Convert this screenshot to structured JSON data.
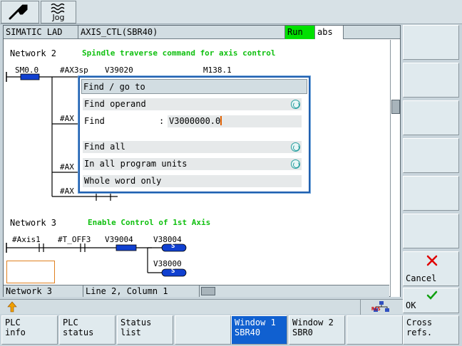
{
  "toolbar": {
    "wrench_icon": "wrench-icon",
    "jog_label": "Jog"
  },
  "editor": {
    "lad_label": "SIMATIC LAD",
    "block_label": "AXIS_CTL(SBR40)",
    "run_label": "Run",
    "abs_label": "abs",
    "status": {
      "network": "Network 3",
      "position": "Line  2, Column  1"
    }
  },
  "ladder": {
    "network2": {
      "title": "Network 2",
      "comment": "Spindle traverse command for axis control",
      "labels": {
        "sm": "SM0.0",
        "ax3sp": "#AX3sp",
        "v39020": "V39020",
        "m138": "M138.1",
        "ax_a": "#AX",
        "ax_b": "#AX",
        "ax_c": "#AX"
      }
    },
    "network3": {
      "title": "Network 3",
      "comment": "Enable Control of 1st Axis",
      "labels": {
        "axis1": "#Axis1",
        "toff3": "#T_OFF3",
        "v39004": "V39004",
        "v38004": "V38004",
        "v38000": "V38000",
        "coil_s1": "S",
        "coil_s2": "S"
      }
    }
  },
  "dialog": {
    "title": "Find / go to",
    "find_operand": "Find operand",
    "find_label": "Find",
    "find_colon": ":",
    "find_value": "V3000000.0",
    "find_all": "Find all",
    "in_all_units": "In all program units",
    "whole_word": "Whole word only"
  },
  "right_keys": {
    "cancel": "Cancel",
    "ok": "OK"
  },
  "hint": {
    "rcs_label": "RCS"
  },
  "bottom_keys": [
    {
      "label": "PLC\ninfo",
      "active": false
    },
    {
      "label": "PLC\nstatus",
      "active": false
    },
    {
      "label": "Status\nlist",
      "active": false
    },
    {
      "label": "",
      "active": false
    },
    {
      "label": "Window 1\nSBR40",
      "active": true
    },
    {
      "label": "Window 2\nSBR0",
      "active": false
    },
    {
      "label": "",
      "active": false
    },
    {
      "label": "Cross\nrefs.",
      "active": false
    }
  ],
  "colors": {
    "run": "#00e000",
    "comment": "#10c010",
    "active_key": "#1060d0",
    "contact": "#1040d0",
    "dialog_border": "#2060b0"
  }
}
